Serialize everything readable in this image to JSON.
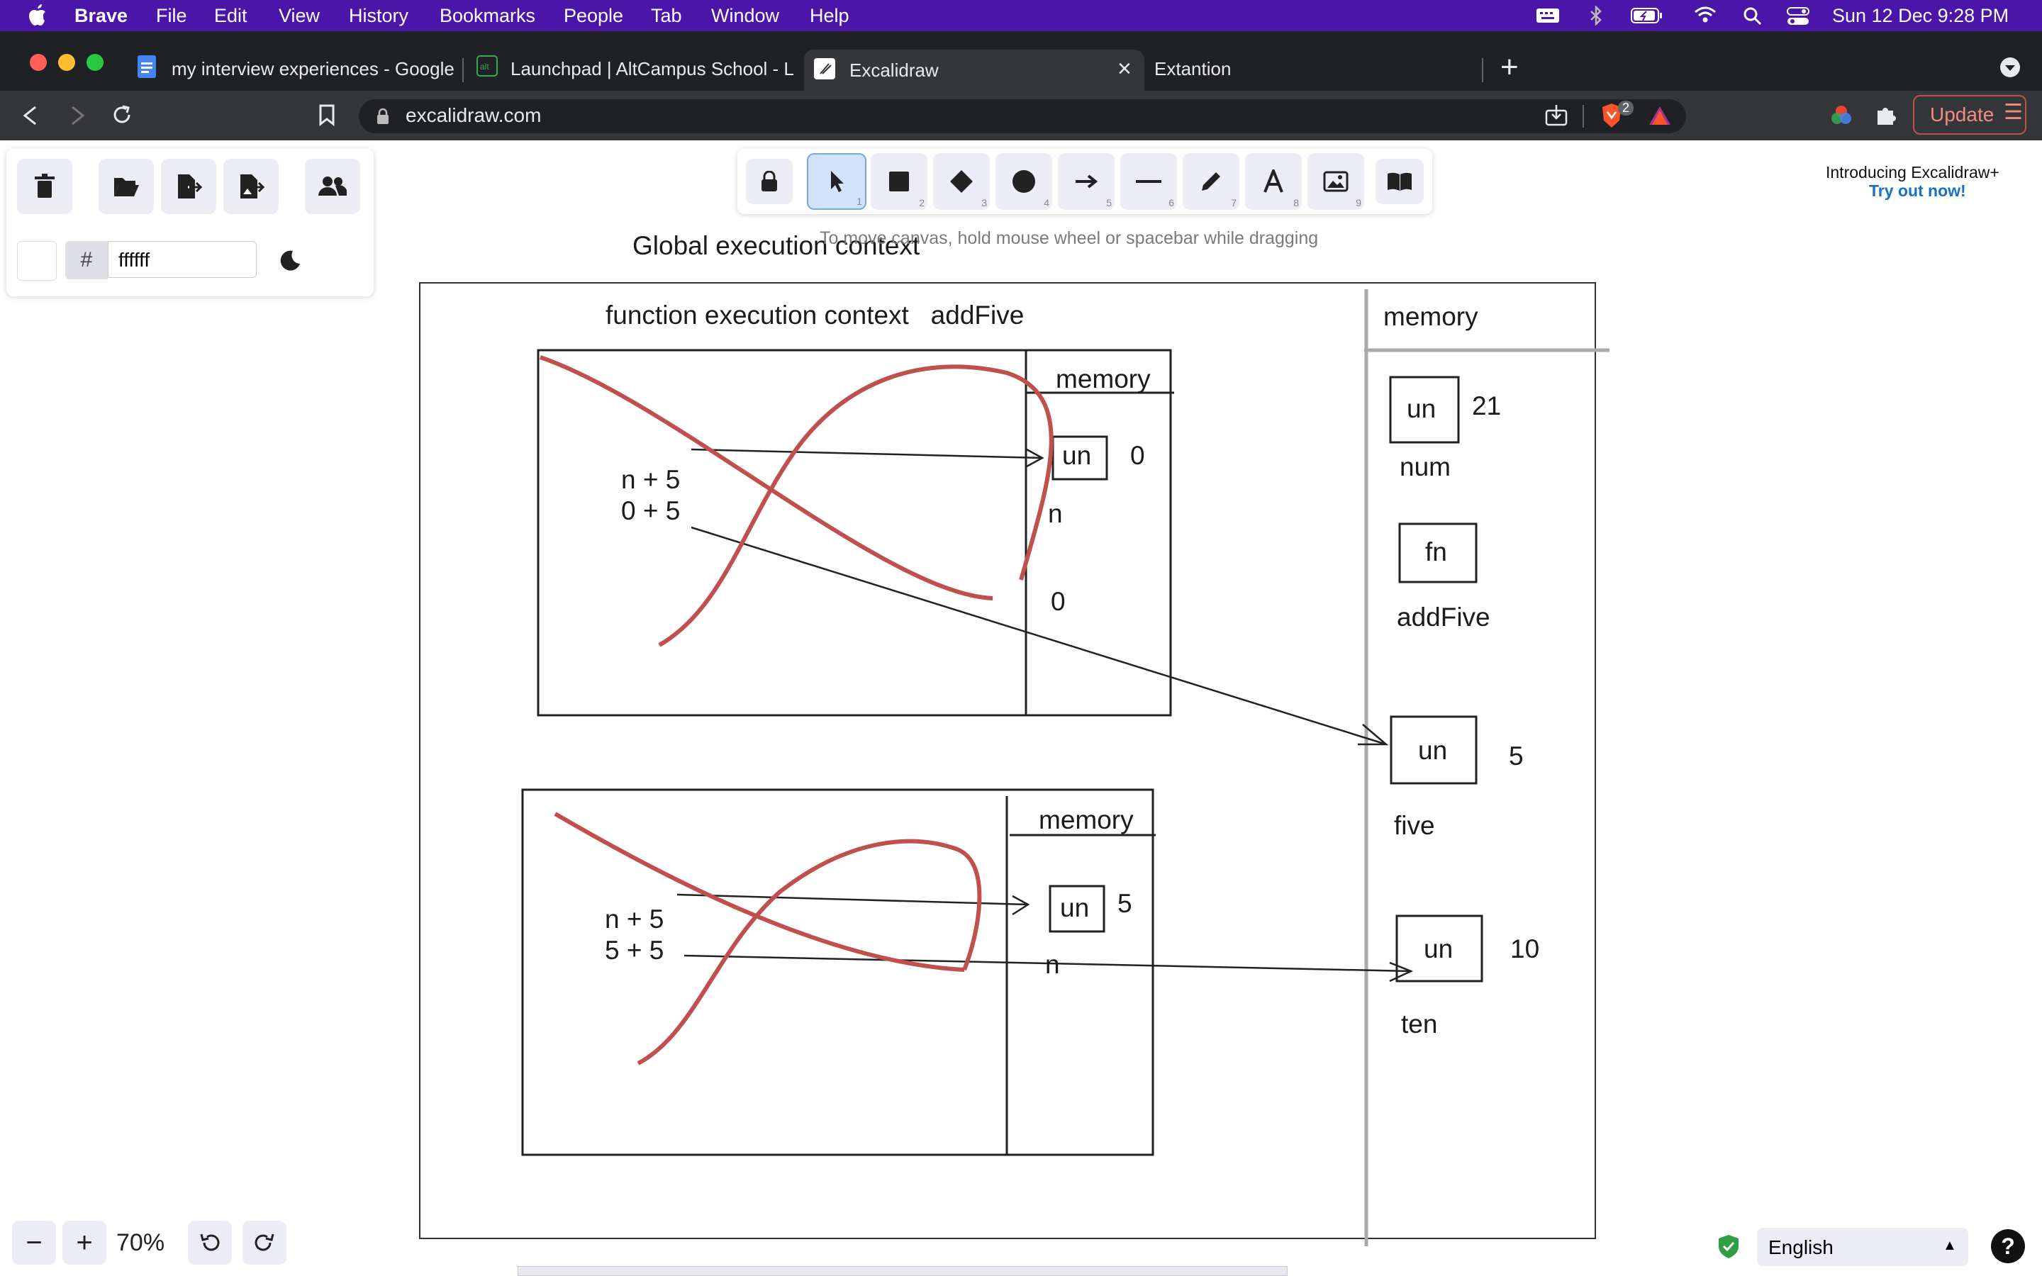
{
  "menubar": {
    "app": "Brave",
    "items": [
      "File",
      "Edit",
      "View",
      "History",
      "Bookmarks",
      "People",
      "Tab",
      "Window",
      "Help"
    ],
    "datetime": "Sun 12 Dec  9:28 PM"
  },
  "tabs": [
    {
      "label": "my interview experiences - Google"
    },
    {
      "label": "Launchpad | AltCampus School - Le"
    },
    {
      "label": "Excalidraw"
    },
    {
      "label": "Extantion"
    }
  ],
  "address": {
    "url": "excalidraw.com",
    "update_label": "Update",
    "brave_badge": "2"
  },
  "panel": {
    "hex_prefix": "#",
    "color_value": "ffffff"
  },
  "toolbar": {
    "numbers": [
      "1",
      "2",
      "3",
      "4",
      "5",
      "6",
      "7",
      "8",
      "9"
    ]
  },
  "canvas": {
    "hint": "To move canvas, hold mouse wheel or spacebar while dragging",
    "promo_title": "Introducing Excalidraw+",
    "promo_link": "Try out now!",
    "global_title": "Global execution context",
    "function_title": "function execution context   addFive",
    "memory_main": "memory",
    "memory_box1": "memory",
    "memory_box2": "memory",
    "top_expr1": "n + 5",
    "top_expr2": "0 + 5",
    "top_un": "un",
    "top_zero1": "0",
    "top_n": "n",
    "top_zero2": "0",
    "bot_expr1": "n + 5",
    "bot_expr2": "5 + 5",
    "bot_un": "un",
    "bot_five": "5",
    "bot_n": "n",
    "g_un1": "un",
    "g_21": "21",
    "g_num": "num",
    "g_fn": "fn",
    "g_addfive": "addFive",
    "g_un2": "un",
    "g_5": "5",
    "g_five": "five",
    "g_un3": "un",
    "g_10": "10",
    "g_ten": "ten"
  },
  "zoom": {
    "value": "70%",
    "minus": "−",
    "plus": "+"
  },
  "language": "English",
  "help": "?",
  "colors": {
    "menubar": "#4b16a8",
    "sketch_red": "#c0504d",
    "accent": "#1971c2"
  }
}
